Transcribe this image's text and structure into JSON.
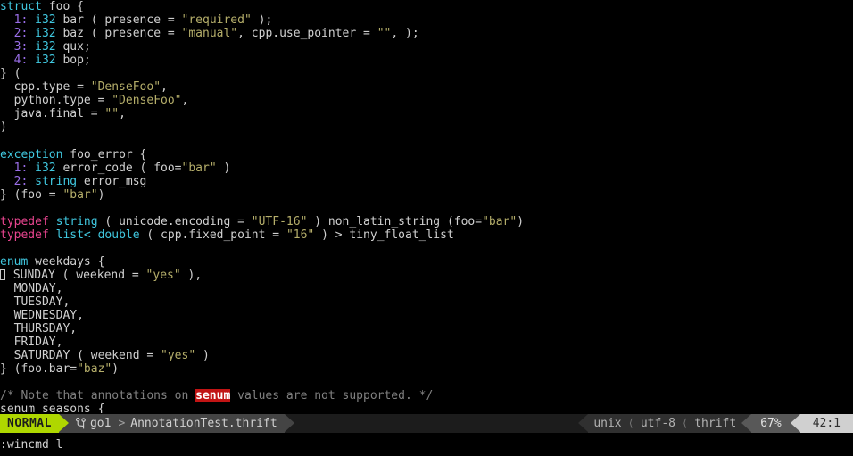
{
  "editor": {
    "filetype": "thrift",
    "background": "#000000",
    "foreground": "#d0d0d0",
    "colors": {
      "keyword": "#40c8e0",
      "typedef": "#e8458f",
      "field_number": "#9a6ee8",
      "string": "#b5ae6a",
      "comment": "#808080",
      "search_highlight_bg": "#c11414",
      "search_highlight_fg": "#ffffff",
      "statusline_mode_bg": "#afd700"
    }
  },
  "buffer": {
    "lines": [
      {
        "id": 1,
        "segments": [
          {
            "t": "struct",
            "c": "kw"
          },
          {
            "t": " foo {",
            "c": "plain"
          }
        ]
      },
      {
        "id": 2,
        "segments": [
          {
            "t": "  ",
            "c": "plain"
          },
          {
            "t": "1:",
            "c": "num"
          },
          {
            "t": " ",
            "c": "plain"
          },
          {
            "t": "i32",
            "c": "kw"
          },
          {
            "t": " bar ( presence = ",
            "c": "plain"
          },
          {
            "t": "\"required\"",
            "c": "str"
          },
          {
            "t": " );",
            "c": "plain"
          }
        ]
      },
      {
        "id": 3,
        "segments": [
          {
            "t": "  ",
            "c": "plain"
          },
          {
            "t": "2:",
            "c": "num"
          },
          {
            "t": " ",
            "c": "plain"
          },
          {
            "t": "i32",
            "c": "kw"
          },
          {
            "t": " baz ( presence = ",
            "c": "plain"
          },
          {
            "t": "\"manual\"",
            "c": "str"
          },
          {
            "t": ", cpp.use_pointer = ",
            "c": "plain"
          },
          {
            "t": "\"\"",
            "c": "str"
          },
          {
            "t": ", );",
            "c": "plain"
          }
        ]
      },
      {
        "id": 4,
        "segments": [
          {
            "t": "  ",
            "c": "plain"
          },
          {
            "t": "3:",
            "c": "num"
          },
          {
            "t": " ",
            "c": "plain"
          },
          {
            "t": "i32",
            "c": "kw"
          },
          {
            "t": " qux;",
            "c": "plain"
          }
        ]
      },
      {
        "id": 5,
        "segments": [
          {
            "t": "  ",
            "c": "plain"
          },
          {
            "t": "4:",
            "c": "num"
          },
          {
            "t": " ",
            "c": "plain"
          },
          {
            "t": "i32",
            "c": "kw"
          },
          {
            "t": " bop;",
            "c": "plain"
          }
        ]
      },
      {
        "id": 6,
        "segments": [
          {
            "t": "} (",
            "c": "plain"
          }
        ]
      },
      {
        "id": 7,
        "segments": [
          {
            "t": "  cpp.type = ",
            "c": "plain"
          },
          {
            "t": "\"DenseFoo\"",
            "c": "str"
          },
          {
            "t": ",",
            "c": "plain"
          }
        ]
      },
      {
        "id": 8,
        "segments": [
          {
            "t": "  python.type = ",
            "c": "plain"
          },
          {
            "t": "\"DenseFoo\"",
            "c": "str"
          },
          {
            "t": ",",
            "c": "plain"
          }
        ]
      },
      {
        "id": 9,
        "segments": [
          {
            "t": "  java.final = ",
            "c": "plain"
          },
          {
            "t": "\"\"",
            "c": "str"
          },
          {
            "t": ",",
            "c": "plain"
          }
        ]
      },
      {
        "id": 10,
        "segments": [
          {
            "t": ")",
            "c": "plain"
          }
        ]
      },
      {
        "id": 11,
        "segments": [
          {
            "t": "",
            "c": "plain"
          }
        ]
      },
      {
        "id": 12,
        "segments": [
          {
            "t": "exception",
            "c": "kw"
          },
          {
            "t": " foo_error {",
            "c": "plain"
          }
        ]
      },
      {
        "id": 13,
        "segments": [
          {
            "t": "  ",
            "c": "plain"
          },
          {
            "t": "1:",
            "c": "num"
          },
          {
            "t": " ",
            "c": "plain"
          },
          {
            "t": "i32",
            "c": "kw"
          },
          {
            "t": " error_code ( foo=",
            "c": "plain"
          },
          {
            "t": "\"bar\"",
            "c": "str"
          },
          {
            "t": " )",
            "c": "plain"
          }
        ]
      },
      {
        "id": 14,
        "segments": [
          {
            "t": "  ",
            "c": "plain"
          },
          {
            "t": "2:",
            "c": "num"
          },
          {
            "t": " ",
            "c": "plain"
          },
          {
            "t": "string",
            "c": "kw"
          },
          {
            "t": " error_msg",
            "c": "plain"
          }
        ]
      },
      {
        "id": 15,
        "segments": [
          {
            "t": "} (foo = ",
            "c": "plain"
          },
          {
            "t": "\"bar\"",
            "c": "str"
          },
          {
            "t": ")",
            "c": "plain"
          }
        ]
      },
      {
        "id": 16,
        "segments": [
          {
            "t": "",
            "c": "plain"
          }
        ]
      },
      {
        "id": 17,
        "segments": [
          {
            "t": "typedef",
            "c": "typedef"
          },
          {
            "t": " ",
            "c": "plain"
          },
          {
            "t": "string",
            "c": "kw"
          },
          {
            "t": " ( unicode.encoding = ",
            "c": "plain"
          },
          {
            "t": "\"UTF-16\"",
            "c": "str"
          },
          {
            "t": " ) non_latin_string (foo=",
            "c": "plain"
          },
          {
            "t": "\"bar\"",
            "c": "str"
          },
          {
            "t": ")",
            "c": "plain"
          }
        ]
      },
      {
        "id": 18,
        "segments": [
          {
            "t": "typedef",
            "c": "typedef"
          },
          {
            "t": " ",
            "c": "plain"
          },
          {
            "t": "list<",
            "c": "kw"
          },
          {
            "t": " ",
            "c": "plain"
          },
          {
            "t": "double",
            "c": "kw"
          },
          {
            "t": " ( cpp.fixed_point = ",
            "c": "plain"
          },
          {
            "t": "\"16\"",
            "c": "str"
          },
          {
            "t": " ) > tiny_float_list",
            "c": "plain"
          }
        ]
      },
      {
        "id": 19,
        "segments": [
          {
            "t": "",
            "c": "plain"
          }
        ]
      },
      {
        "id": 20,
        "segments": [
          {
            "t": "enum",
            "c": "kw"
          },
          {
            "t": " weekdays {",
            "c": "plain"
          }
        ]
      },
      {
        "id": 21,
        "cursor": true,
        "segments": [
          {
            "t": " SUNDAY ( weekend = ",
            "c": "plain"
          },
          {
            "t": "\"yes\"",
            "c": "str"
          },
          {
            "t": " ),",
            "c": "plain"
          }
        ]
      },
      {
        "id": 22,
        "segments": [
          {
            "t": "  MONDAY,",
            "c": "plain"
          }
        ]
      },
      {
        "id": 23,
        "segments": [
          {
            "t": "  TUESDAY,",
            "c": "plain"
          }
        ]
      },
      {
        "id": 24,
        "segments": [
          {
            "t": "  WEDNESDAY,",
            "c": "plain"
          }
        ]
      },
      {
        "id": 25,
        "segments": [
          {
            "t": "  THURSDAY,",
            "c": "plain"
          }
        ]
      },
      {
        "id": 26,
        "segments": [
          {
            "t": "  FRIDAY,",
            "c": "plain"
          }
        ]
      },
      {
        "id": 27,
        "segments": [
          {
            "t": "  SATURDAY ( weekend = ",
            "c": "plain"
          },
          {
            "t": "\"yes\"",
            "c": "str"
          },
          {
            "t": " )",
            "c": "plain"
          }
        ]
      },
      {
        "id": 28,
        "segments": [
          {
            "t": "} (foo.bar=",
            "c": "plain"
          },
          {
            "t": "\"baz\"",
            "c": "str"
          },
          {
            "t": ")",
            "c": "plain"
          }
        ]
      },
      {
        "id": 29,
        "segments": [
          {
            "t": "",
            "c": "plain"
          }
        ]
      },
      {
        "id": 30,
        "segments": [
          {
            "t": "/* Note that annotations on ",
            "c": "comment"
          },
          {
            "t": "senum",
            "c": "search"
          },
          {
            "t": " values are not supported. */",
            "c": "comment"
          }
        ]
      },
      {
        "id": 31,
        "segments": [
          {
            "t": "senum seasons {",
            "c": "plain"
          }
        ]
      }
    ]
  },
  "statusline": {
    "mode": "NORMAL",
    "branch_icon": "git-branch-icon",
    "branch_glyph": "⑂",
    "branch": "go1",
    "path_separator": ">",
    "filename": "AnnotationTest.thrift",
    "file_format": "unix",
    "encoding": "utf-8",
    "filetype": "thrift",
    "percent": "67%",
    "position": "42:1"
  },
  "cmdline": {
    "text": ":wincmd l"
  }
}
